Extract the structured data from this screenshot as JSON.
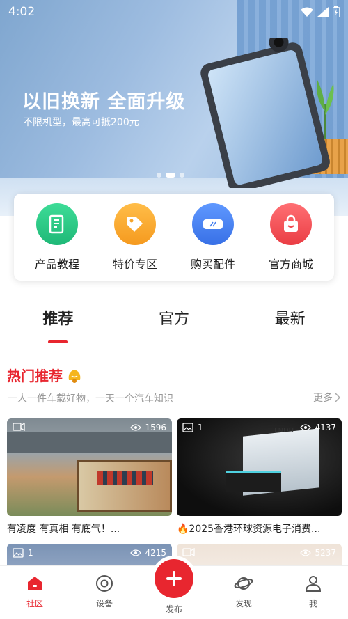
{
  "status_bar": {
    "time": "4:02"
  },
  "banner": {
    "headline": "以旧换新 全面升级",
    "subline": "不限机型，最高可抵200元",
    "active_dot": 2
  },
  "quick_actions": [
    {
      "label": "产品教程",
      "icon": "book-icon",
      "color": "#2ec98a"
    },
    {
      "label": "特价专区",
      "icon": "price-tag-icon",
      "color": "#f7a830"
    },
    {
      "label": "购买配件",
      "icon": "accessory-icon",
      "color": "#4b86f2"
    },
    {
      "label": "官方商城",
      "icon": "shopping-bag-icon",
      "color": "#f2545a"
    }
  ],
  "tabs": [
    {
      "label": "推荐"
    },
    {
      "label": "官方"
    },
    {
      "label": "最新"
    }
  ],
  "hot": {
    "title": "热门推荐",
    "subtitle": "一人一件车载好物，一天一个汽车知识",
    "more_label": "更多"
  },
  "cards": [
    {
      "caption": "有凌度 有真相 有底气！...",
      "views": "1596",
      "media": "video-icon",
      "count": ""
    },
    {
      "caption": "🔥2025香港环球资源电子消费...",
      "views": "4137",
      "media": "image-icon",
      "count": "1"
    },
    {
      "caption": "",
      "views": "4215",
      "media": "image-icon",
      "count": "1"
    },
    {
      "caption": "",
      "views": "5237",
      "media": "video-icon",
      "count": ""
    }
  ],
  "bottom_nav": [
    {
      "label": "社区",
      "icon": "home-icon",
      "active": true
    },
    {
      "label": "设备",
      "icon": "device-icon",
      "active": false
    },
    {
      "label": "发布",
      "icon": "plus-icon",
      "active": false
    },
    {
      "label": "发现",
      "icon": "planet-icon",
      "active": false
    },
    {
      "label": "我",
      "icon": "user-icon",
      "active": false
    }
  ],
  "colors": {
    "accent": "#e8262f"
  }
}
